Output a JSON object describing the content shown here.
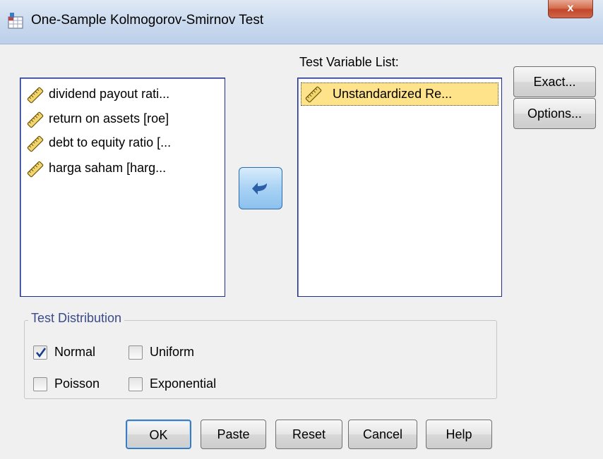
{
  "window": {
    "title": "One-Sample Kolmogorov-Smirnov Test",
    "close_label": "x"
  },
  "source_list": {
    "items": [
      {
        "label": "dividend payout rati...",
        "icon": "scale-variable-icon"
      },
      {
        "label": "return on assets [roe]",
        "icon": "scale-variable-icon"
      },
      {
        "label": "debt to equity ratio [...",
        "icon": "scale-variable-icon"
      },
      {
        "label": "harga saham [harg...",
        "icon": "scale-variable-icon"
      }
    ]
  },
  "move_button": {
    "icon": "arrow-left-icon"
  },
  "target_list": {
    "caption": "Test Variable List:",
    "items": [
      {
        "label": "Unstandardized Re...",
        "icon": "scale-variable-icon",
        "selected": true
      }
    ]
  },
  "side_buttons": {
    "exact": "Exact...",
    "options": "Options..."
  },
  "test_distribution": {
    "legend": "Test Distribution",
    "options": [
      {
        "label": "Normal",
        "checked": true
      },
      {
        "label": "Uniform",
        "checked": false
      },
      {
        "label": "Poisson",
        "checked": false
      },
      {
        "label": "Exponential",
        "checked": false
      }
    ]
  },
  "footer_buttons": {
    "ok": "OK",
    "paste": "Paste",
    "reset": "Reset",
    "cancel": "Cancel",
    "help": "Help"
  },
  "colors": {
    "selection": "#ffe38a",
    "list_border": "#1f2f8a",
    "legend_text": "#3a4a8a"
  }
}
